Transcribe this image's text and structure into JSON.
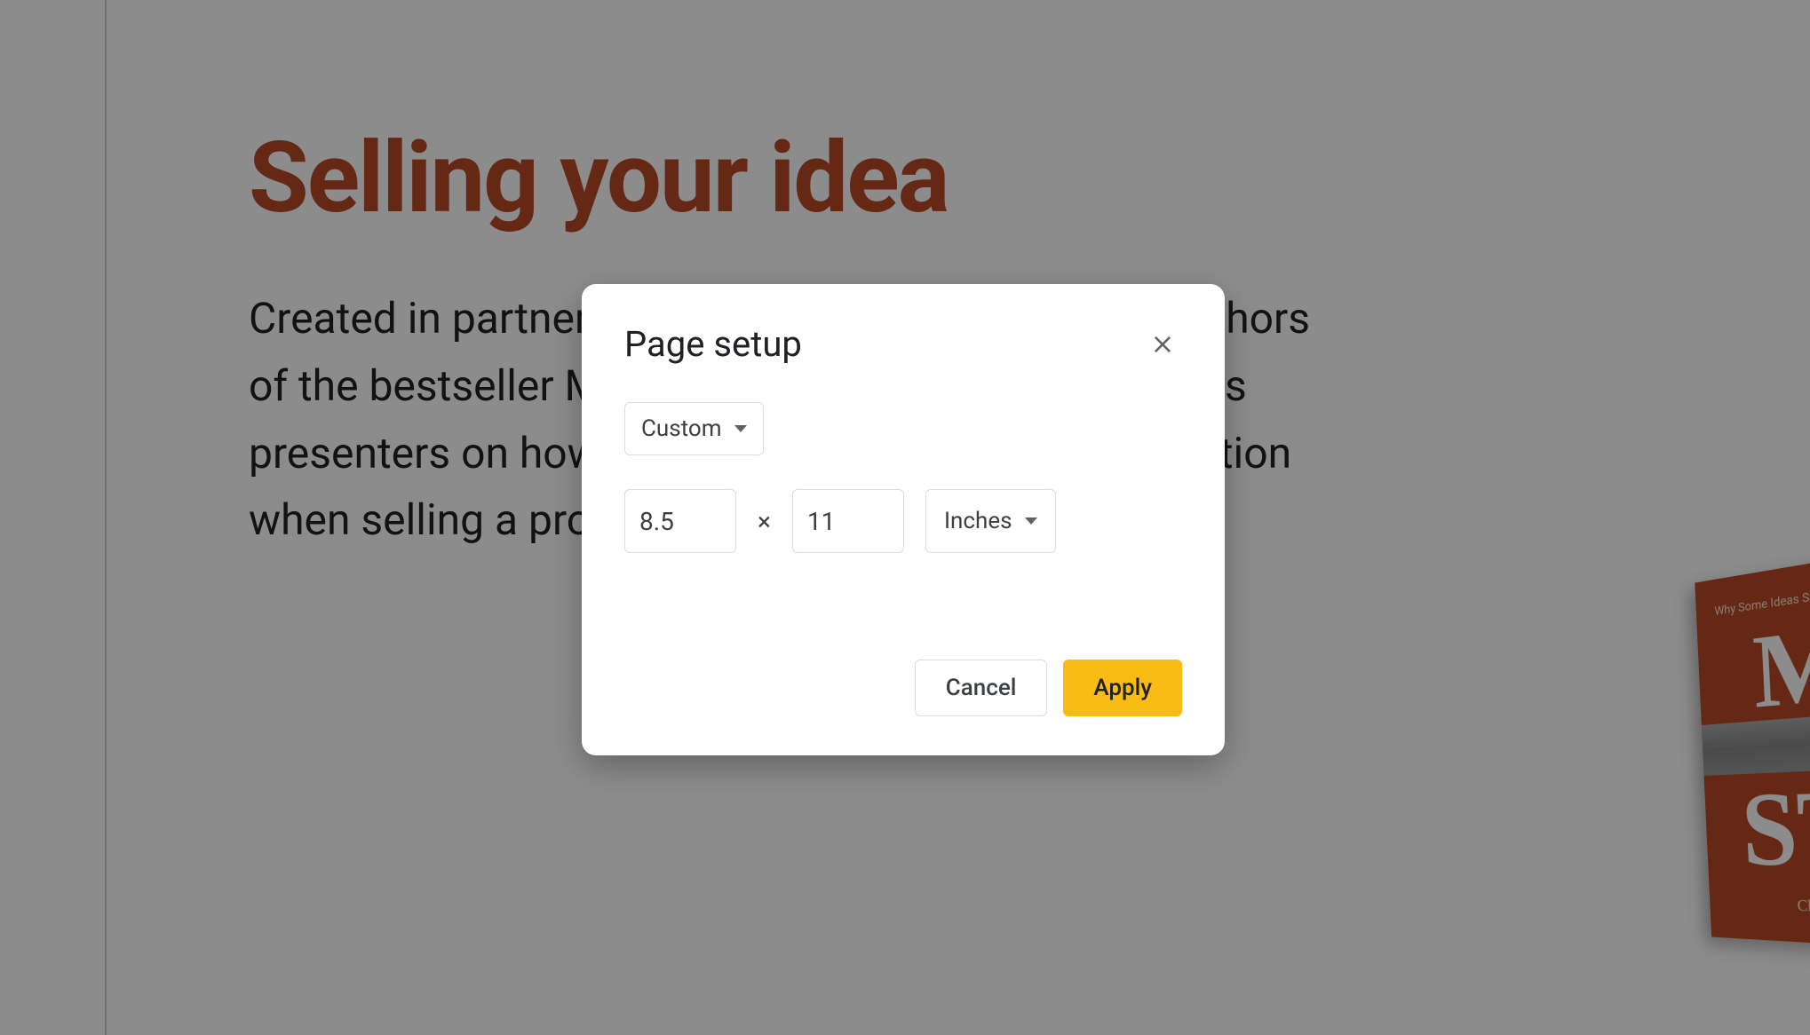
{
  "slide": {
    "title": "Selling your idea",
    "body": "Created in partnership with Chip and Dan Heath, authors of the bestseller Made to Stick, this template advises presenters on how to deliver a memorable presentation when selling a product, service, or idea."
  },
  "book": {
    "top_text": "Why Some Ideas Survive",
    "letter1": "M",
    "letter2": "ST",
    "author": "Chip Heath"
  },
  "dialog": {
    "title": "Page setup",
    "preset_label": "Custom",
    "width": "8.5",
    "height": "11",
    "units_label": "Inches",
    "cancel_label": "Cancel",
    "apply_label": "Apply"
  }
}
